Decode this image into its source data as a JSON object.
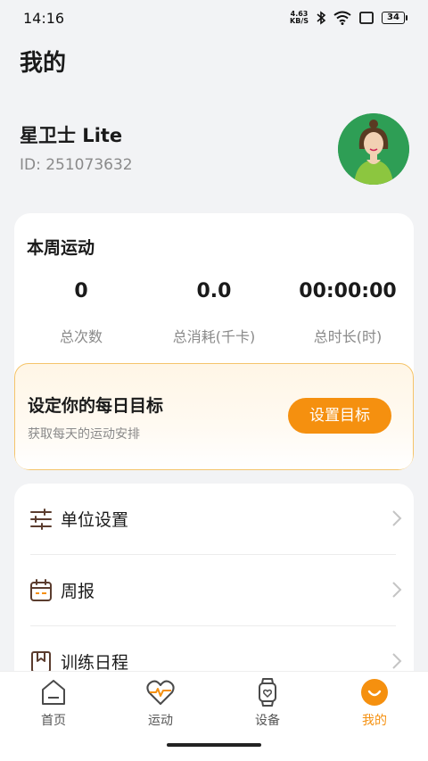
{
  "status_bar": {
    "time": "14:16",
    "net_speed_value": "4.63",
    "net_speed_unit": "KB/S",
    "battery": "34",
    "icons": [
      "bluetooth-icon",
      "wifi-icon",
      "screen-icon",
      "battery-icon"
    ]
  },
  "page": {
    "title": "我的"
  },
  "profile": {
    "name": "星卫士 Lite",
    "id_text": "ID: 251073632",
    "avatar_color": "#2e9e55"
  },
  "weekly": {
    "title": "本周运动",
    "stats": [
      {
        "value": "0",
        "label": "总次数"
      },
      {
        "value": "0.0",
        "label": "总消耗(千卡)"
      },
      {
        "value": "00:00:00",
        "label": "总时长(时)"
      }
    ]
  },
  "goal": {
    "title": "设定你的每日目标",
    "subtitle": "获取每天的运动安排",
    "button": "设置目标",
    "accent": "#f5900f"
  },
  "menu": {
    "items": [
      {
        "label": "单位设置",
        "icon": "sliders-icon"
      },
      {
        "label": "周报",
        "icon": "calendar-icon"
      },
      {
        "label": "训练日程",
        "icon": "bookmark-book-icon"
      }
    ]
  },
  "tabs": [
    {
      "label": "首页",
      "icon": "home-icon"
    },
    {
      "label": "运动",
      "icon": "heart-pulse-icon"
    },
    {
      "label": "设备",
      "icon": "watch-icon"
    },
    {
      "label": "我的",
      "icon": "profile-icon",
      "active": true
    }
  ]
}
